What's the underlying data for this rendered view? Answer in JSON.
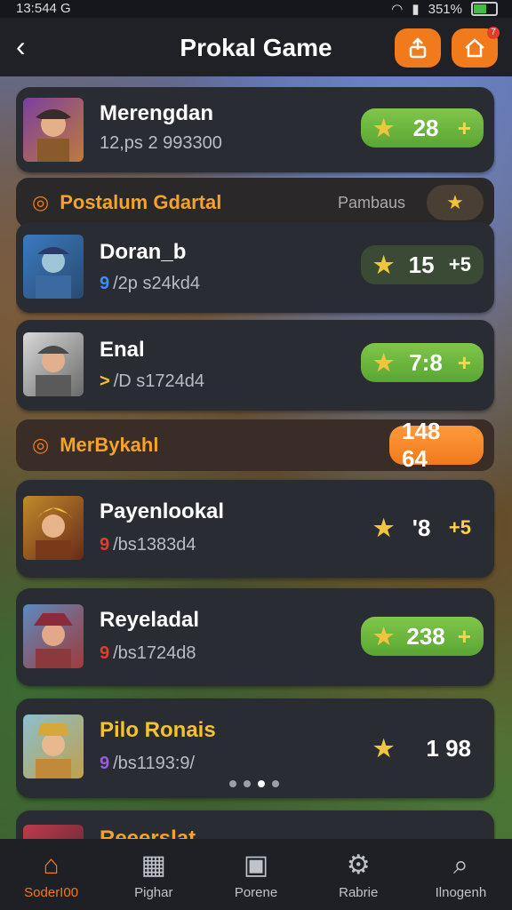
{
  "status": {
    "time": "13:544 G",
    "battery": "351%"
  },
  "header": {
    "title": "Prokal Game",
    "badge": "7"
  },
  "items": [
    {
      "name": "Merengdan",
      "sub": "12,ps 2 993300",
      "dot": "",
      "score": "28",
      "plus": "+",
      "star": "★"
    },
    {
      "name": "Doran_b",
      "sub": "/2p s24kd4",
      "dot": "9",
      "score": "15",
      "plus": "+5",
      "star": "★"
    },
    {
      "name": "Enal",
      "sub": "/D s1724d4",
      "dot": ">",
      "score": "7:8",
      "plus": "+",
      "star": "★"
    },
    {
      "name": "Payenlookal",
      "sub": "/bs1383d4",
      "dot": "9",
      "score": "'8",
      "plus": "+5",
      "star": "★"
    },
    {
      "name": "Reyeladal",
      "sub": "/bs1724d8",
      "dot": "9",
      "score": "238",
      "plus": "+",
      "star": "★"
    },
    {
      "name": "Pilo Ronais",
      "sub": "/bs1193:9/",
      "dot": "9",
      "score": "1 98",
      "plus": "",
      "star": "★"
    },
    {
      "name": "Reeerslat",
      "sub": "",
      "dot": "",
      "score": "",
      "plus": "",
      "star": ""
    }
  ],
  "sections": [
    {
      "title": "Postalum Gdartal",
      "right": "Pambaus",
      "icon": "◎"
    },
    {
      "title": "MerBykahl",
      "right": "",
      "value": "148 64",
      "icon": "◎"
    }
  ],
  "nav": [
    {
      "label": "SoderI00",
      "icon": "⌂"
    },
    {
      "label": "Pighar",
      "icon": "▦"
    },
    {
      "label": "Porene",
      "icon": "▣"
    },
    {
      "label": "Rabrie",
      "icon": "⚙"
    },
    {
      "label": "Ilnogenh",
      "icon": "⌕"
    }
  ],
  "colors": {
    "accent": "#f07a1c",
    "green": "#6bb63e",
    "bg": "#1f2127"
  }
}
